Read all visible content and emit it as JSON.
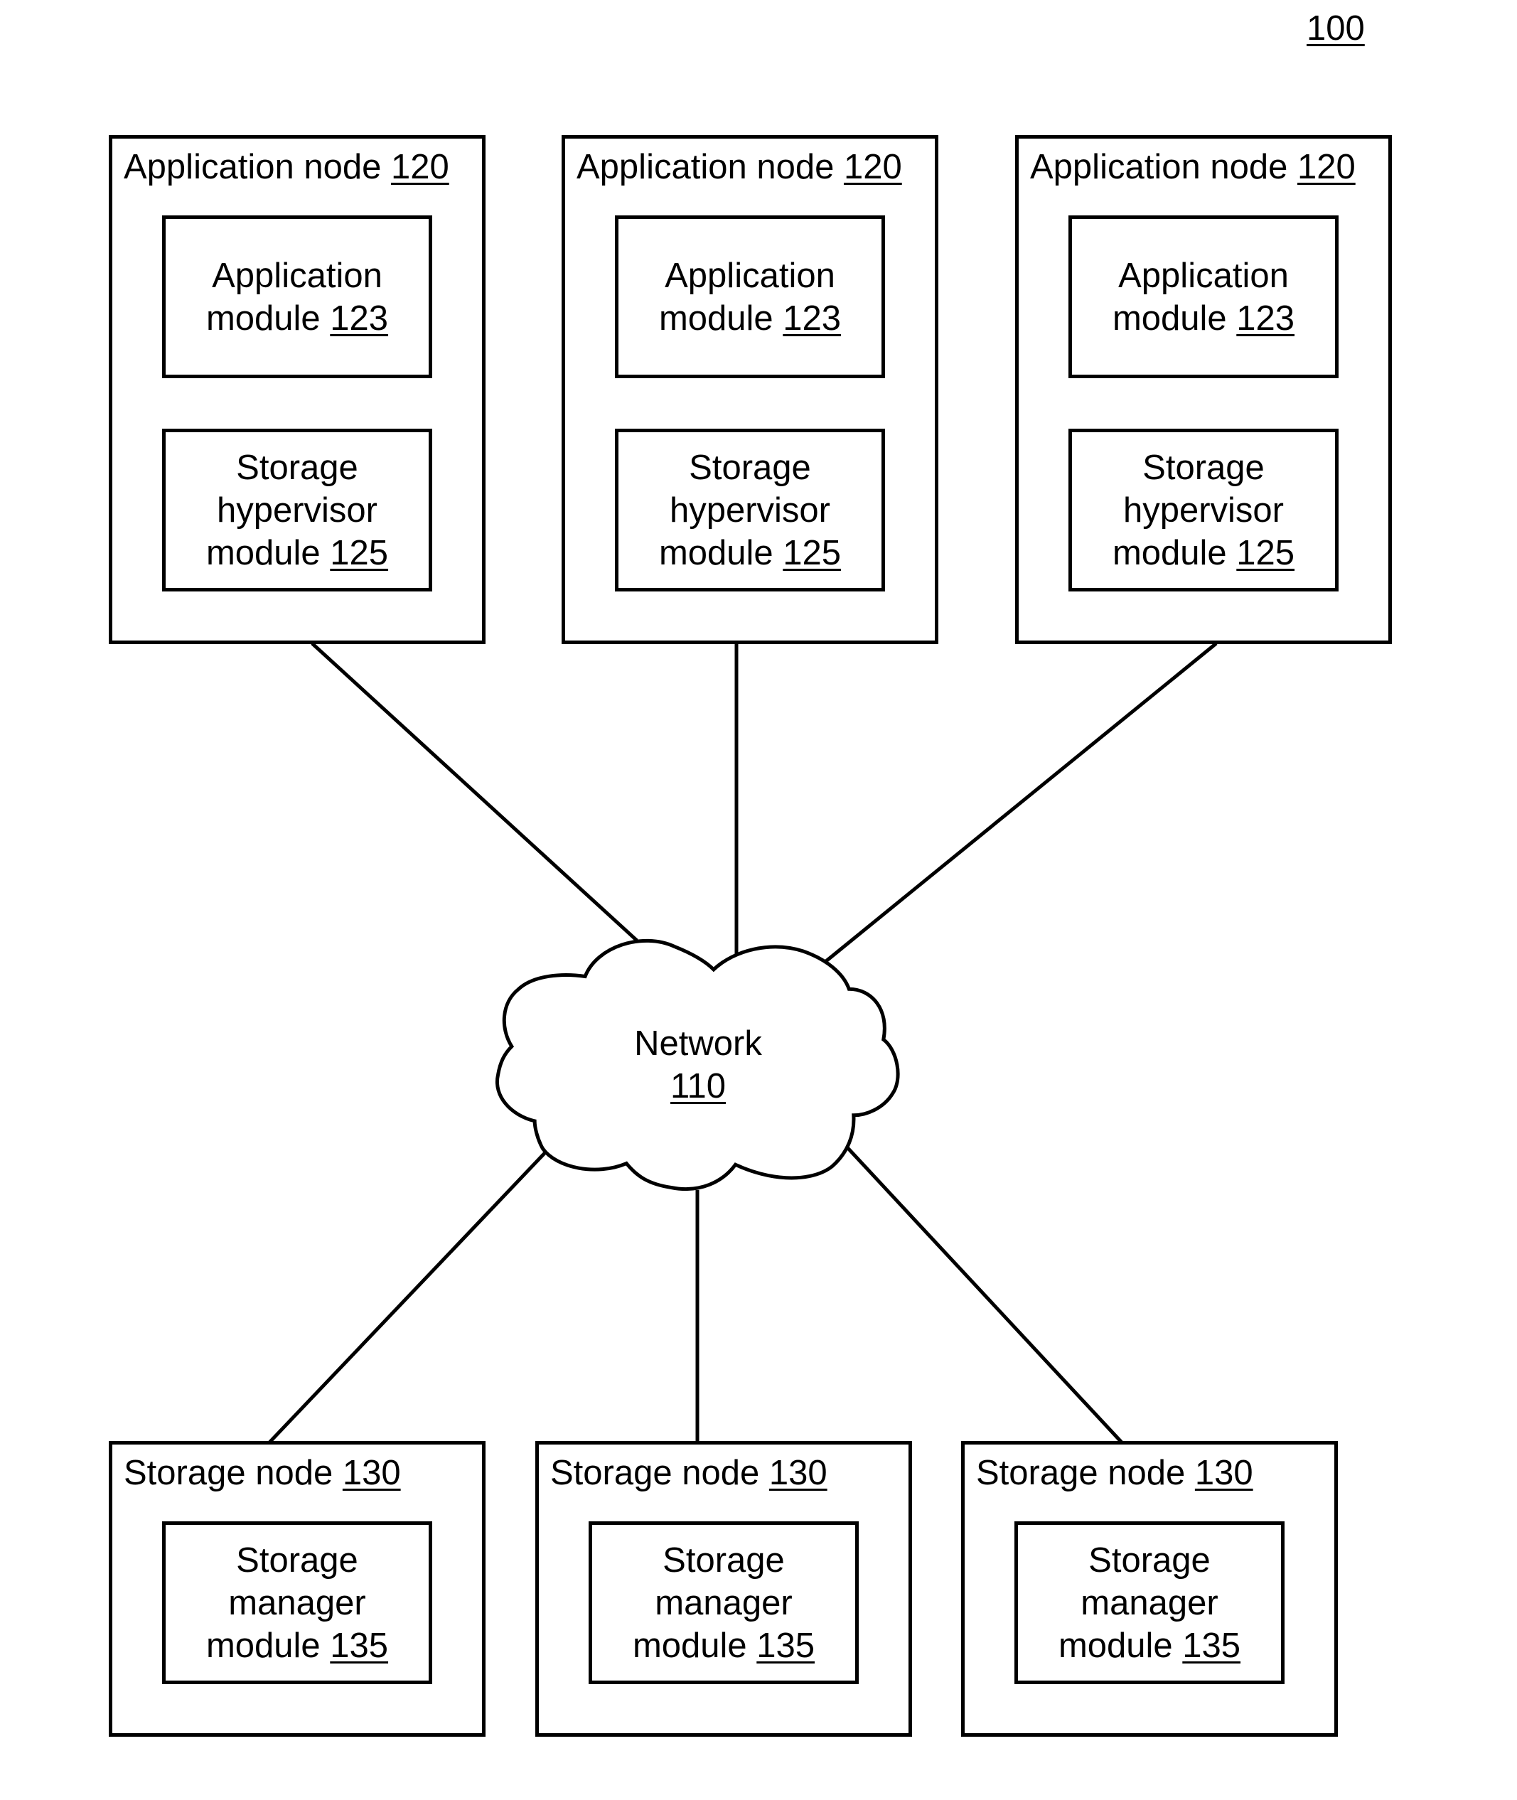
{
  "figure": {
    "ref": "100"
  },
  "network": {
    "label": "Network",
    "ref": "110"
  },
  "application_nodes": [
    {
      "title": "Application node",
      "ref": "120",
      "app_module": {
        "line1": "Application",
        "line2": "module",
        "ref": "123"
      },
      "hypervisor_module": {
        "line1": "Storage",
        "line2": "hypervisor",
        "line3": "module",
        "ref": "125"
      }
    },
    {
      "title": "Application node",
      "ref": "120",
      "app_module": {
        "line1": "Application",
        "line2": "module",
        "ref": "123"
      },
      "hypervisor_module": {
        "line1": "Storage",
        "line2": "hypervisor",
        "line3": "module",
        "ref": "125"
      }
    },
    {
      "title": "Application node",
      "ref": "120",
      "app_module": {
        "line1": "Application",
        "line2": "module",
        "ref": "123"
      },
      "hypervisor_module": {
        "line1": "Storage",
        "line2": "hypervisor",
        "line3": "module",
        "ref": "125"
      }
    }
  ],
  "storage_nodes": [
    {
      "title": "Storage node",
      "ref": "130",
      "manager_module": {
        "line1": "Storage",
        "line2": "manager",
        "line3": "module",
        "ref": "135"
      }
    },
    {
      "title": "Storage node",
      "ref": "130",
      "manager_module": {
        "line1": "Storage",
        "line2": "manager",
        "line3": "module",
        "ref": "135"
      }
    },
    {
      "title": "Storage node",
      "ref": "130",
      "manager_module": {
        "line1": "Storage",
        "line2": "manager",
        "line3": "module",
        "ref": "135"
      }
    }
  ],
  "connections": [
    {
      "from": "application_node_1",
      "to": "network"
    },
    {
      "from": "application_node_2",
      "to": "network"
    },
    {
      "from": "application_node_3",
      "to": "network"
    },
    {
      "from": "network",
      "to": "storage_node_1"
    },
    {
      "from": "network",
      "to": "storage_node_2"
    },
    {
      "from": "network",
      "to": "storage_node_3"
    }
  ]
}
